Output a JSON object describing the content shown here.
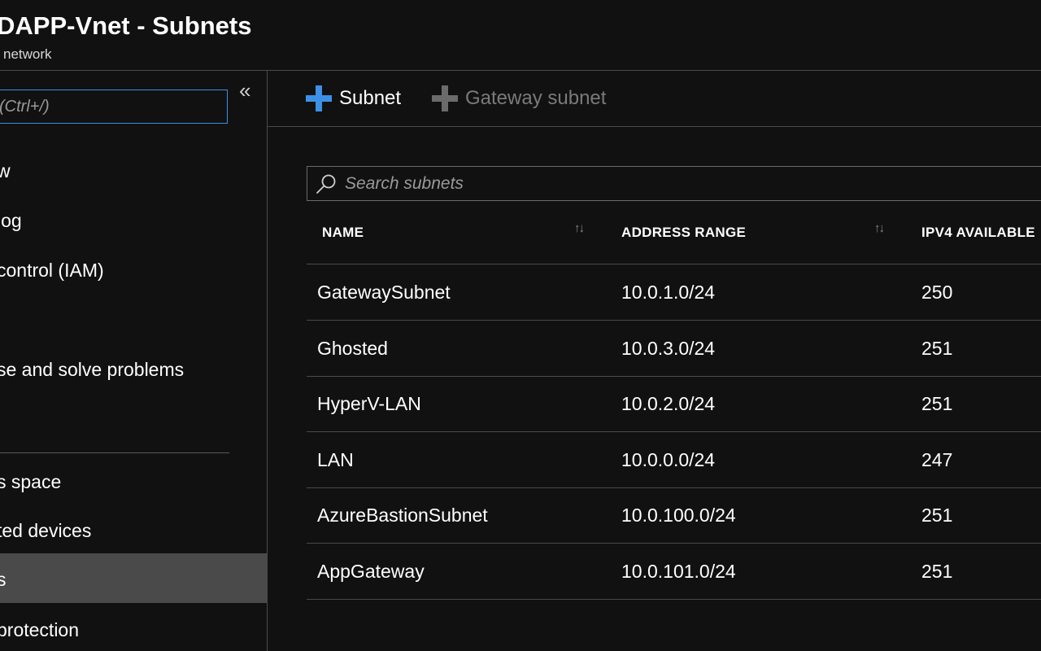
{
  "header": {
    "title": "DAPP-Vnet - Subnets",
    "subtitle": "network"
  },
  "sidebar": {
    "search_placeholder": "(Ctrl+/)",
    "collapse_glyph": "«",
    "items": [
      {
        "label": "w",
        "selected": false
      },
      {
        "label": "log",
        "selected": false
      },
      {
        "label": "control (IAM)",
        "selected": false
      },
      {
        "label": "se and solve problems",
        "selected": false
      },
      {
        "label": "s space",
        "selected": false
      },
      {
        "label": "ted devices",
        "selected": false
      },
      {
        "label": "s",
        "selected": true
      },
      {
        "label": "protection",
        "selected": false
      }
    ]
  },
  "toolbar": {
    "add_subnet_label": "Subnet",
    "add_gateway_subnet_label": "Gateway subnet"
  },
  "grid": {
    "search_placeholder": "Search subnets",
    "columns": [
      "NAME",
      "ADDRESS RANGE",
      "IPV4 AVAILABLE"
    ],
    "sort_glyph": "↑↓",
    "rows": [
      {
        "name": "GatewaySubnet",
        "range": "10.0.1.0/24",
        "ipv4": "250"
      },
      {
        "name": "Ghosted",
        "range": "10.0.3.0/24",
        "ipv4": "251"
      },
      {
        "name": "HyperV-LAN",
        "range": "10.0.2.0/24",
        "ipv4": "251"
      },
      {
        "name": "LAN",
        "range": "10.0.0.0/24",
        "ipv4": "247"
      },
      {
        "name": "AzureBastionSubnet",
        "range": "10.0.100.0/24",
        "ipv4": "251"
      },
      {
        "name": "AppGateway",
        "range": "10.0.101.0/24",
        "ipv4": "251"
      }
    ]
  },
  "colors": {
    "background": "#111111",
    "accent_blue": "#3c91e6",
    "selected_row": "#4a4a4a",
    "divider": "#4a4a4a"
  },
  "icons": {
    "collapse": "double-chevron-left-icon",
    "add_subnet": "plus-icon",
    "add_gateway_subnet": "plus-icon",
    "search": "search-icon",
    "sort": "sort-arrows-icon"
  }
}
